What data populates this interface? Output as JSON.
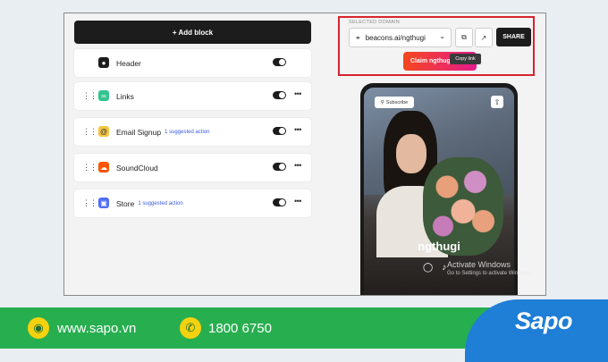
{
  "editor": {
    "add_block_label": "+ Add block",
    "blocks": [
      {
        "label": "Header",
        "suggestion": "",
        "icon": "person-icon",
        "color": "#1c1c1c"
      },
      {
        "label": "Links",
        "suggestion": "",
        "icon": "link-icon",
        "color": "#34c38f"
      },
      {
        "label": "Email Signup",
        "suggestion": "1 suggested action",
        "icon": "at-icon",
        "color": "#f4c542"
      },
      {
        "label": "SoundCloud",
        "suggestion": "",
        "icon": "soundcloud-icon",
        "color": "#ff5500"
      },
      {
        "label": "Store",
        "suggestion": "1 suggested action",
        "icon": "store-icon",
        "color": "#4f6df5"
      }
    ]
  },
  "domain_panel": {
    "label": "SELECTED DOMAIN",
    "domain": "beacons.ai/ngthugi",
    "share_label": "SHARE",
    "claim_label": "Claim ngthugi",
    "tooltip": "Copy link"
  },
  "preview": {
    "subscribe_label": "Subscribe",
    "profile_name": "ngthugi"
  },
  "watermark": {
    "title": "Activate Windows",
    "subtitle": "Go to Settings to activate Windows."
  },
  "footer": {
    "website": "www.sapo.vn",
    "phone": "1800 6750",
    "brand": "Sapo"
  },
  "colors": {
    "footer_green": "#27ae4f",
    "brand_blue": "#1f7ed6",
    "highlight_red": "#d9232d"
  }
}
